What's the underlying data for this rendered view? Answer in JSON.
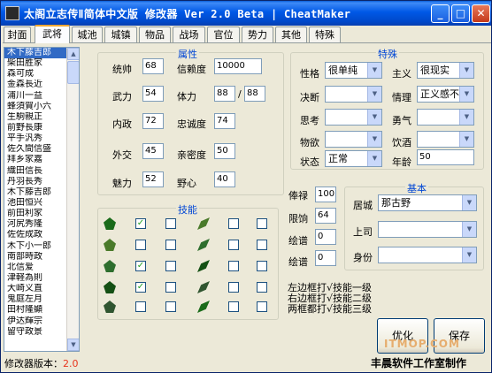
{
  "window": {
    "title": "太阁立志传Ⅱ简体中文版 修改器 Ver 2.0  Beta | CheatMaker",
    "controls": {
      "minimize": "_",
      "maximize": "□",
      "close": "✕"
    }
  },
  "tabs": [
    "封面",
    "武将",
    "城池",
    "城镇",
    "物品",
    "战场",
    "官位",
    "势力",
    "其他",
    "特殊"
  ],
  "general_list": {
    "items": [
      "木下藤吉郎",
      "柴田胜家",
      "森可成",
      "金森長近",
      "浦川一益",
      "蜂須賀小六",
      "生駒親正",
      "前野長康",
      "平手汎秀",
      "佐久間信盛",
      "拜乡家嘉",
      "織田信長",
      "丹羽長秀",
      "木下藤吉郎",
      "池田恒兴",
      "前田利家",
      "河尻秀隆",
      "佐佐成政",
      "木下小一郎",
      "南部時政",
      "北信爱",
      "津軽為則",
      "大崎义直",
      "鬼庭左月",
      "田村隆顯",
      "伊达輝宗",
      "留守政景"
    ],
    "selected_index": 0
  },
  "version": {
    "label": "修改器版本：",
    "value": "2.0"
  },
  "attributes": {
    "title": "属性",
    "fields": [
      {
        "label": "统帅",
        "value": "68"
      },
      {
        "label": "信赖度",
        "value": "10000"
      },
      {
        "label": "武力",
        "value": "54"
      },
      {
        "label": "体力",
        "value": "88",
        "max": "88"
      },
      {
        "label": "内政",
        "value": "72"
      },
      {
        "label": "忠诚度",
        "value": "74"
      },
      {
        "label": "外交",
        "value": "45"
      },
      {
        "label": "亲密度",
        "value": "50"
      },
      {
        "label": "魅力",
        "value": "52"
      },
      {
        "label": "野心",
        "value": "40"
      }
    ],
    "separator": "/"
  },
  "special": {
    "title": "特殊",
    "rows": [
      {
        "label": "性格",
        "value": "很单纯"
      },
      {
        "label": "主义",
        "value": "很现实"
      },
      {
        "label": "决断",
        "value": ""
      },
      {
        "label": "情理",
        "value": "正义感不"
      },
      {
        "label": "思考",
        "value": ""
      },
      {
        "label": "勇气",
        "value": ""
      },
      {
        "label": "物欲",
        "value": ""
      },
      {
        "label": "饮酒",
        "value": ""
      },
      {
        "label": "状态",
        "value": "正常"
      },
      {
        "label": "年龄",
        "value": "50"
      }
    ]
  },
  "skills": {
    "title": "技能",
    "check_glyph": "✓",
    "rows": [
      {
        "icons": [
          "sword-cross-icon",
          "spear-icon"
        ],
        "checks": [
          true,
          false,
          false,
          false,
          false,
          false
        ]
      },
      {
        "icons": [
          "grid-formation-icon",
          "horse-icon"
        ],
        "checks": [
          false,
          false,
          false,
          false,
          true,
          false
        ]
      },
      {
        "icons": [
          "castle-icon",
          "mountain-icon"
        ],
        "checks": [
          true,
          false,
          false,
          false,
          false,
          false
        ]
      },
      {
        "icons": [
          "helmet-icon",
          "rifle-icon"
        ],
        "checks": [
          true,
          false,
          false,
          false,
          false,
          false
        ]
      },
      {
        "icons": [
          "fan-icon",
          "cannon-icon"
        ],
        "checks": [
          false,
          false,
          false,
          false,
          false,
          false
        ]
      }
    ]
  },
  "salary": {
    "fields": [
      {
        "label": "俸禄",
        "value": "100"
      },
      {
        "label": "限饷",
        "value": "64"
      },
      {
        "label": "绘谱",
        "value": "0"
      },
      {
        "label": "绘谱",
        "value": "0"
      }
    ]
  },
  "basic": {
    "title": "基本",
    "rows": [
      {
        "label": "居城",
        "value": "那古野"
      },
      {
        "label": "上司",
        "value": ""
      },
      {
        "label": "身份",
        "value": ""
      }
    ]
  },
  "hints": [
    "左边框打√技能一级",
    "右边框打√技能二级",
    "两框都打√技能三级"
  ],
  "buttons": {
    "optimize": "优化",
    "save": "保存"
  },
  "credit": "丰晨软件工作室制作",
  "watermark": "ITMOP.COM"
}
